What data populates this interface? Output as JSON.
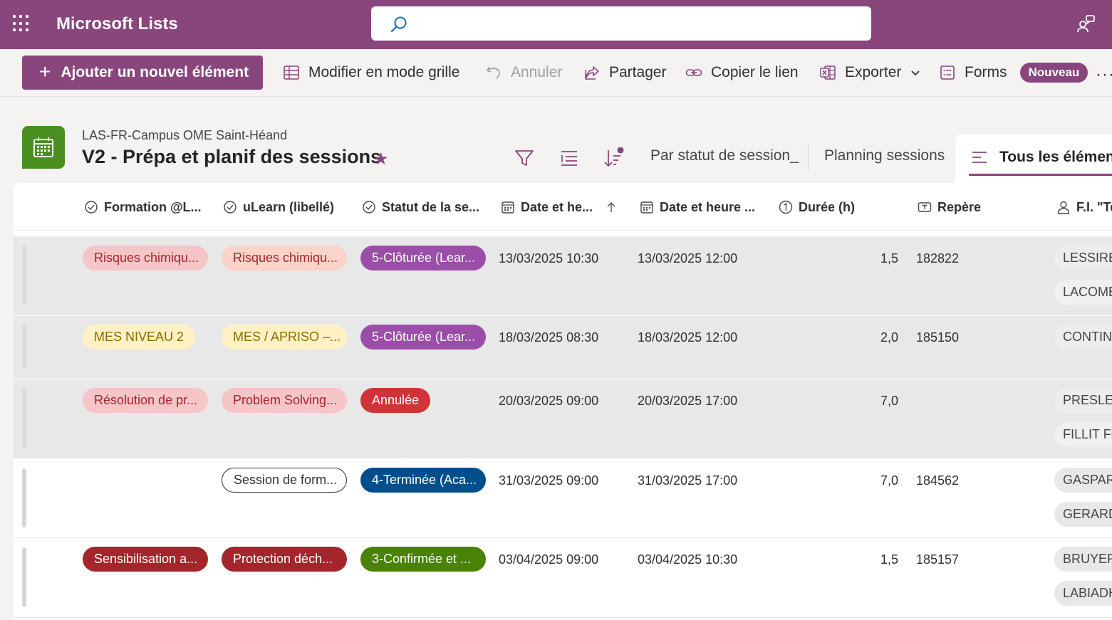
{
  "suite": {
    "app_title": "Microsoft Lists",
    "search_placeholder": ""
  },
  "commands": {
    "add_label": "Ajouter un nouvel élément",
    "grid_label": "Modifier en mode grille",
    "undo_label": "Annuler",
    "share_label": "Partager",
    "copy_link_label": "Copier le lien",
    "export_label": "Exporter",
    "forms_label": "Forms",
    "new_badge": "Nouveau",
    "more": "···"
  },
  "list": {
    "site_name": "LAS-FR-Campus OME Saint-Héand",
    "title": "V2 - Prépa et planif des sessions",
    "favorite_icon": "★",
    "views": [
      "Par statut de session_",
      "Planning sessions",
      "Tous les éléments"
    ]
  },
  "columns": {
    "formation": "Formation @L...",
    "ulearn": "uLearn (libellé)",
    "statut": "Statut de la se...",
    "date_start": "Date et he...",
    "date_end": "Date et heure ...",
    "duree": "Durée (h)",
    "repere": "Repère",
    "fi": "F.I. \"Te"
  },
  "rows": [
    {
      "formation": "Risques chimiqu...",
      "formation_bg": "#f6c5c8",
      "formation_fg": "#a4262c",
      "ulearn": "Risques chimiqu...",
      "ulearn_bg": "#fbd3c8",
      "ulearn_fg": "#a4262c",
      "statut": "5-Clôturée (Lear...",
      "statut_bg": "#9b4ea8",
      "statut_fg": "#ffffff",
      "date_start": "13/03/2025 10:30",
      "date_end": "13/03/2025 12:00",
      "duree": "1,5",
      "repere": "182822",
      "persons": [
        "LESSIRE S",
        "LACOMB"
      ]
    },
    {
      "formation": "MES NIVEAU 2",
      "formation_bg": "#fff1c4",
      "formation_fg": "#8a6d00",
      "ulearn": "MES / APRISO –...",
      "ulearn_bg": "#fff1c4",
      "ulearn_fg": "#8a6d00",
      "statut": "5-Clôturée (Lear...",
      "statut_bg": "#9b4ea8",
      "statut_fg": "#ffffff",
      "date_start": "18/03/2025 08:30",
      "date_end": "18/03/2025 12:00",
      "duree": "2,0",
      "repere": "185150",
      "persons": [
        "CONTINC"
      ]
    },
    {
      "formation": "Résolution de pr...",
      "formation_bg": "#f6c5c8",
      "formation_fg": "#a4262c",
      "ulearn": "Problem Solving...",
      "ulearn_bg": "#f6c5c8",
      "ulearn_fg": "#a4262c",
      "statut": "Annulée",
      "statut_bg": "#d13438",
      "statut_fg": "#ffffff",
      "date_start": "20/03/2025 09:00",
      "date_end": "20/03/2025 17:00",
      "duree": "7,0",
      "repere": "",
      "persons": [
        "PRESLE D",
        "FILLIT Fra"
      ]
    },
    {
      "formation": "",
      "formation_bg": "",
      "formation_fg": "",
      "ulearn": "Session de form...",
      "ulearn_bg": "#ffffff",
      "ulearn_fg": "#323130",
      "statut": "4-Terminée (Aca...",
      "statut_bg": "#004e8c",
      "statut_fg": "#ffffff",
      "date_start": "31/03/2025 09:00",
      "date_end": "31/03/2025 17:00",
      "duree": "7,0",
      "repere": "184562",
      "persons": [
        "GASPARI",
        "GERARD"
      ]
    },
    {
      "formation": "Sensibilisation a...",
      "formation_bg": "#a4262c",
      "formation_fg": "#ffffff",
      "ulearn": "Protection déch...",
      "ulearn_bg": "#a4262c",
      "ulearn_fg": "#ffffff",
      "statut": "3-Confirmée et ...",
      "statut_bg": "#498205",
      "statut_fg": "#ffffff",
      "date_start": "03/04/2025 09:00",
      "date_end": "03/04/2025 10:30",
      "duree": "1,5",
      "repere": "185157",
      "persons": [
        "BRUYERE",
        "LABIADH"
      ]
    }
  ]
}
